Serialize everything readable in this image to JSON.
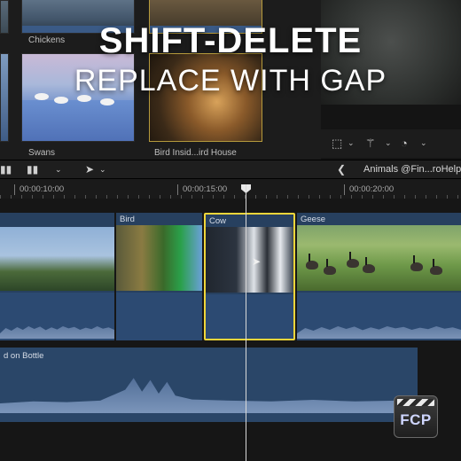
{
  "browser": {
    "clips": [
      {
        "label": "Chickens"
      },
      {
        "label": "Swans"
      },
      {
        "label": "Bird Insid...ird House"
      }
    ]
  },
  "viewer_toolbar": {
    "icons": [
      "transform-icon",
      "magic-wand-icon",
      "speed-icon"
    ]
  },
  "overlay": {
    "title": "SHIFT-DELETE",
    "subtitle": "REPLACE WITH GAP"
  },
  "timeline": {
    "project_name": "Animals @Fin...roHelp",
    "ruler": [
      "00:00:10:00",
      "00:00:15:00",
      "00:00:20:00"
    ],
    "clips": [
      {
        "name": ""
      },
      {
        "name": "Bird"
      },
      {
        "name": "Cow"
      },
      {
        "name": "Geese"
      }
    ],
    "audio_clip": {
      "name": "d on Bottle"
    }
  },
  "badge": {
    "text": "FCP"
  },
  "colors": {
    "selection": "#f0d63a",
    "clip_blue": "#27405f",
    "background": "#141414"
  }
}
